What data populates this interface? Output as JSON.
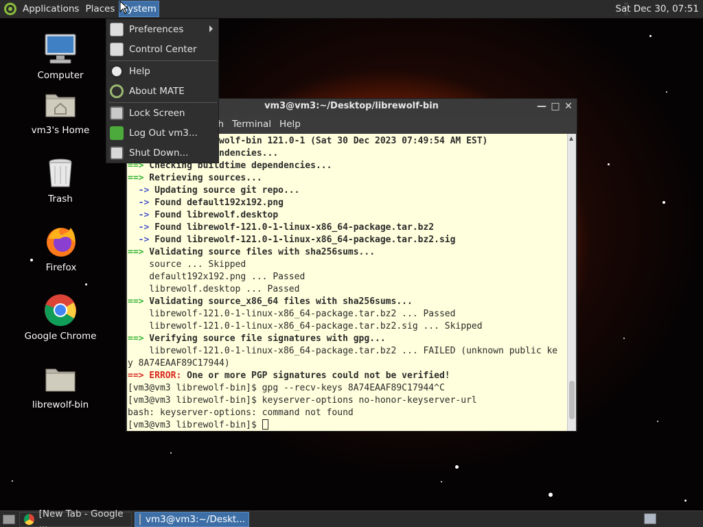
{
  "top_panel": {
    "menus": [
      "Applications",
      "Places",
      "System"
    ],
    "active_menu": "System",
    "clock": "Sat Dec 30, 07:51"
  },
  "desktop_icons": [
    {
      "label": "Computer",
      "icon": "computer-icon"
    },
    {
      "label": "vm3's Home",
      "icon": "home-folder-icon"
    },
    {
      "label": "Trash",
      "icon": "trash-icon"
    },
    {
      "label": "Firefox",
      "icon": "firefox-icon"
    },
    {
      "label": "Google Chrome",
      "icon": "chrome-icon"
    },
    {
      "label": "librewolf-bin",
      "icon": "folder-icon"
    }
  ],
  "system_menu": {
    "items": [
      {
        "label": "Preferences",
        "icon": "preferences-icon",
        "submenu": true
      },
      {
        "label": "Control Center",
        "icon": "control-center-icon"
      },
      {
        "label": "Help",
        "icon": "help-icon"
      },
      {
        "label": "About MATE",
        "icon": "mate-icon"
      },
      {
        "label": "Lock Screen",
        "icon": "lock-screen-icon"
      },
      {
        "label": "Log Out vm3...",
        "icon": "logout-icon"
      },
      {
        "label": "Shut Down...",
        "icon": "shutdown-icon"
      }
    ]
  },
  "terminal": {
    "title": "vm3@vm3:~/Desktop/librewolf-bin",
    "menu": [
      "ch",
      "Terminal",
      "Help"
    ],
    "lines": [
      [
        {
          "t": "        ke: librewolf-bin 121.0-1 (Sat 30 Dec 2023 07:49:54 AM EST)",
          "c": "b"
        }
      ],
      [
        {
          "t": "        time dependencies...",
          "c": "b"
        }
      ],
      [
        {
          "t": "==>",
          "c": "g"
        },
        {
          "t": " Checking buildtime dependencies...",
          "c": "b"
        }
      ],
      [
        {
          "t": "==>",
          "c": "g"
        },
        {
          "t": " Retrieving sources...",
          "c": "b"
        }
      ],
      [
        {
          "t": "  ->",
          "c": "bl"
        },
        {
          "t": " Updating source git repo...",
          "c": "b"
        }
      ],
      [
        {
          "t": "  ->",
          "c": "bl"
        },
        {
          "t": " Found default192x192.png",
          "c": "b"
        }
      ],
      [
        {
          "t": "  ->",
          "c": "bl"
        },
        {
          "t": " Found librewolf.desktop",
          "c": "b"
        }
      ],
      [
        {
          "t": "  ->",
          "c": "bl"
        },
        {
          "t": " Found librewolf-121.0-1-linux-x86_64-package.tar.bz2",
          "c": "b"
        }
      ],
      [
        {
          "t": "  ->",
          "c": "bl"
        },
        {
          "t": " Found librewolf-121.0-1-linux-x86_64-package.tar.bz2.sig",
          "c": "b"
        }
      ],
      [
        {
          "t": "==>",
          "c": "g"
        },
        {
          "t": " Validating source files with sha256sums...",
          "c": "b"
        }
      ],
      [
        {
          "t": "    source ... Skipped",
          "c": ""
        }
      ],
      [
        {
          "t": "    default192x192.png ... Passed",
          "c": ""
        }
      ],
      [
        {
          "t": "    librewolf.desktop ... Passed",
          "c": ""
        }
      ],
      [
        {
          "t": "==>",
          "c": "g"
        },
        {
          "t": " Validating source_x86_64 files with sha256sums...",
          "c": "b"
        }
      ],
      [
        {
          "t": "    librewolf-121.0-1-linux-x86_64-package.tar.bz2 ... Passed",
          "c": ""
        }
      ],
      [
        {
          "t": "    librewolf-121.0-1-linux-x86_64-package.tar.bz2.sig ... Skipped",
          "c": ""
        }
      ],
      [
        {
          "t": "==>",
          "c": "g"
        },
        {
          "t": " Verifying source file signatures with gpg...",
          "c": "b"
        }
      ],
      [
        {
          "t": "    librewolf-121.0-1-linux-x86_64-package.tar.bz2 ... FAILED (unknown public ke",
          "c": ""
        }
      ],
      [
        {
          "t": "y 8A74EAAF89C17944)",
          "c": ""
        }
      ],
      [
        {
          "t": "==>",
          "c": "r"
        },
        {
          "t": " ERROR:",
          "c": "r"
        },
        {
          "t": " One or more PGP signatures could not be verified!",
          "c": "b"
        }
      ],
      [
        {
          "t": "[vm3@vm3 librewolf-bin]$ gpg --recv-keys 8A74EAAF89C17944^C",
          "c": ""
        }
      ],
      [
        {
          "t": "[vm3@vm3 librewolf-bin]$ keyserver-options no-honor-keyserver-url",
          "c": ""
        }
      ],
      [
        {
          "t": "bash: keyserver-options: command not found",
          "c": ""
        }
      ],
      [
        {
          "t": "[vm3@vm3 librewolf-bin]$ ",
          "c": ""
        }
      ]
    ]
  },
  "taskbar": {
    "buttons": [
      {
        "label": "[New Tab - Google ...",
        "icon": "chrome-icon",
        "active": false
      },
      {
        "label": "vm3@vm3:~/Deskt...",
        "icon": "terminal-icon",
        "active": true
      }
    ]
  }
}
